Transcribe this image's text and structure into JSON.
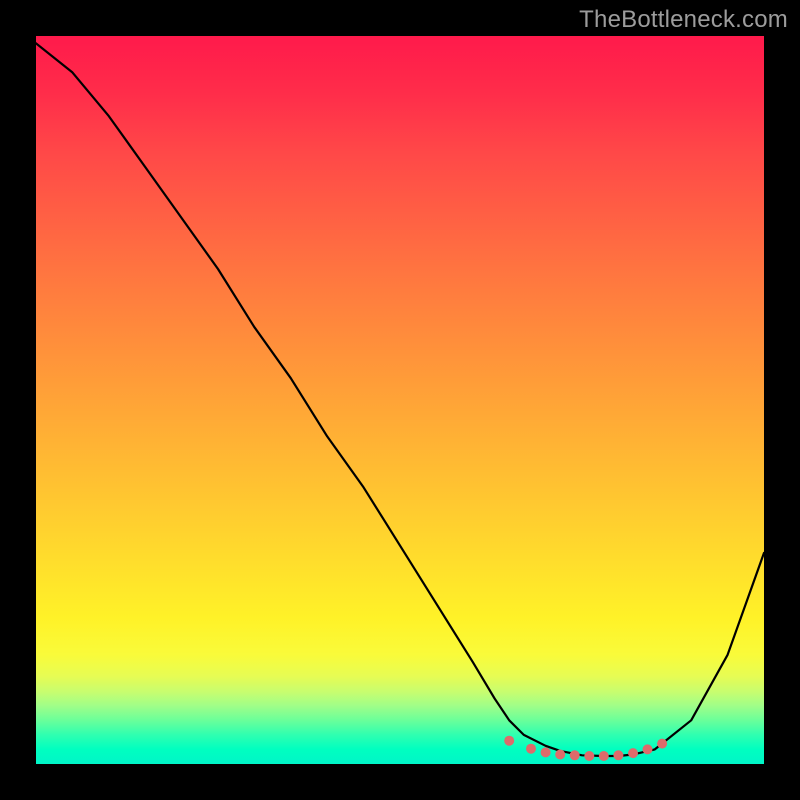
{
  "watermark": "TheBottleneck.com",
  "chart_data": {
    "type": "line",
    "title": "",
    "xlabel": "",
    "ylabel": "",
    "xlim": [
      0,
      100
    ],
    "ylim": [
      0,
      100
    ],
    "background": "rainbow-vertical",
    "curve": {
      "x": [
        0,
        5,
        10,
        15,
        20,
        25,
        30,
        35,
        40,
        45,
        50,
        55,
        60,
        63,
        65,
        67,
        70,
        72,
        75,
        78,
        80,
        82,
        85,
        90,
        95,
        100
      ],
      "y": [
        99,
        95,
        89,
        82,
        75,
        68,
        60,
        53,
        45,
        38,
        30,
        22,
        14,
        9,
        6,
        4,
        2.5,
        1.8,
        1.2,
        1.1,
        1.1,
        1.3,
        2,
        6,
        15,
        29
      ]
    },
    "markers": {
      "x": [
        65,
        68,
        70,
        72,
        74,
        76,
        78,
        80,
        82,
        84,
        86
      ],
      "y": [
        3.2,
        2.1,
        1.6,
        1.3,
        1.2,
        1.1,
        1.1,
        1.2,
        1.5,
        2.0,
        2.8
      ]
    }
  }
}
